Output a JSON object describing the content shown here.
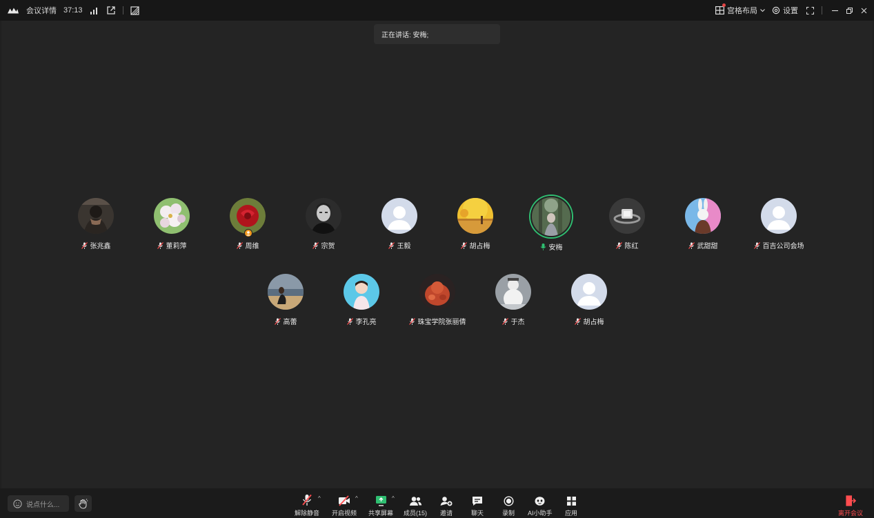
{
  "topbar": {
    "meeting_details": "会议详情",
    "duration": "37:13",
    "layout_label": "宫格布局",
    "settings_label": "设置"
  },
  "speaking_banner": "正在讲话: 安梅;",
  "participants": [
    {
      "name": "张兆鑫",
      "avatar": "photo-person-dark"
    },
    {
      "name": "董莉萍",
      "avatar": "photo-flowers-white"
    },
    {
      "name": "周维",
      "avatar": "photo-red-rose",
      "host": true
    },
    {
      "name": "宗贺",
      "avatar": "photo-man-bw"
    },
    {
      "name": "王毅",
      "avatar": "default-avatar"
    },
    {
      "name": "胡占梅",
      "avatar": "photo-autumn-tree"
    },
    {
      "name": "安梅",
      "avatar": "photo-forest-person",
      "speaking": true
    },
    {
      "name": "陈红",
      "avatar": "photo-diamond-ring"
    },
    {
      "name": "武甜甜",
      "avatar": "photo-cartoon-bunny"
    },
    {
      "name": "百吉公司会场",
      "avatar": "default-avatar"
    },
    {
      "name": "高蕾",
      "avatar": "photo-beach-person"
    },
    {
      "name": "李孔亮",
      "avatar": "photo-child-blue"
    },
    {
      "name": "珠宝学院张丽倩",
      "avatar": "photo-carving-red"
    },
    {
      "name": "于杰",
      "avatar": "photo-snowman"
    },
    {
      "name": "胡占梅",
      "avatar": "default-avatar"
    }
  ],
  "bottombar": {
    "chat_placeholder": "说点什么...",
    "tools": [
      {
        "label": "解除静音",
        "icon": "mic-muted-icon"
      },
      {
        "label": "开启视频",
        "icon": "video-off-icon"
      },
      {
        "label": "共享屏幕",
        "icon": "share-screen-icon"
      },
      {
        "label": "成员(15)",
        "icon": "members-icon"
      },
      {
        "label": "邀请",
        "icon": "invite-icon"
      },
      {
        "label": "聊天",
        "icon": "chat-icon"
      },
      {
        "label": "录制",
        "icon": "record-icon"
      },
      {
        "label": "AI小助手",
        "icon": "ai-assistant-icon"
      },
      {
        "label": "应用",
        "icon": "apps-icon"
      }
    ],
    "leave_label": "离开会议"
  },
  "colors": {
    "speaking_ring": "#2fbf71",
    "leave": "#ff4d4f",
    "muted_mic": "#ff4d4f",
    "host_badge": "#f39a1e"
  }
}
